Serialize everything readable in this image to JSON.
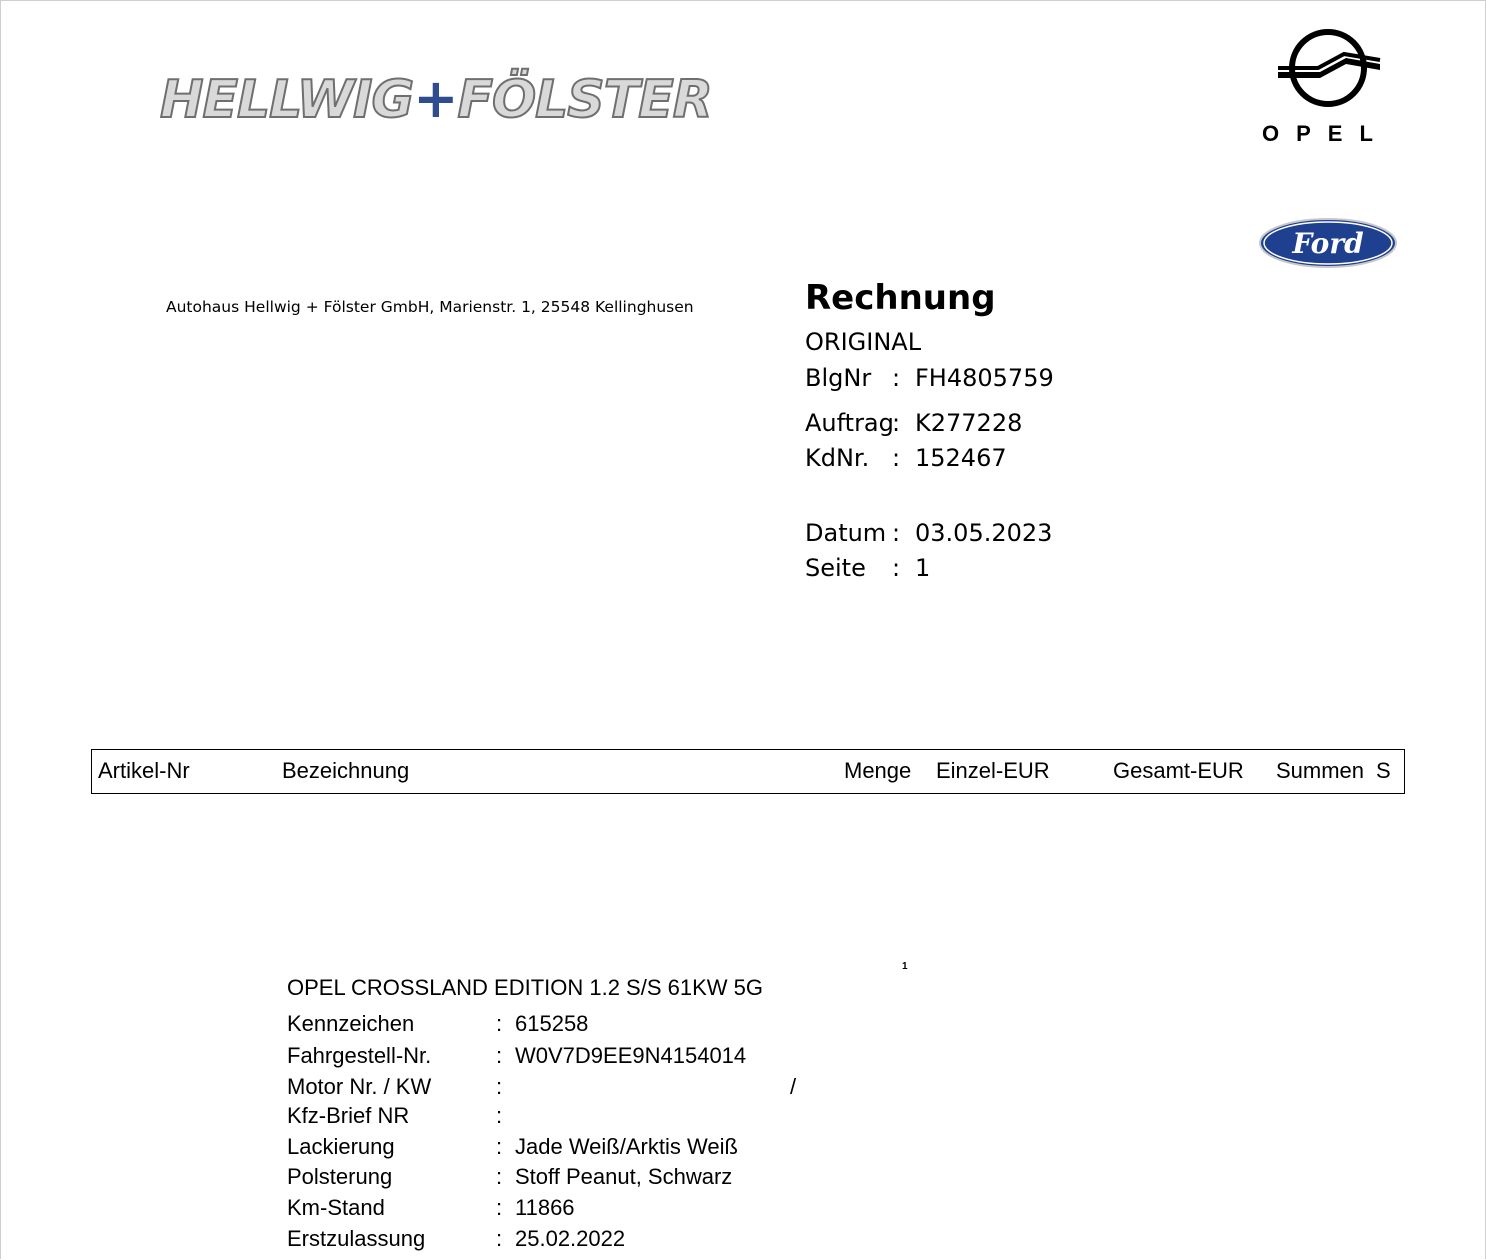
{
  "logos": {
    "dealer_logo_text_left": "HELLWIG",
    "dealer_logo_plus": "+",
    "dealer_logo_text_right": "FÖLSTER",
    "opel_wordmark": "OPEL",
    "ford_wordmark": "Ford",
    "ford_color": "#1f3f8f",
    "dealer_plus_color": "#2d4d8e"
  },
  "sender_line": "Autohaus Hellwig + Fölster GmbH, Marienstr. 1, 25548 Kellinghusen",
  "invoice": {
    "title": "Rechnung",
    "copy_type": "ORIGINAL",
    "fields": [
      {
        "label": "BlgNr",
        "value": "FH4805759"
      },
      {
        "label": "Auftrag",
        "value": "K277228"
      },
      {
        "label": "KdNr.",
        "value": "152467"
      },
      {
        "label": "Datum",
        "value": "03.05.2023"
      },
      {
        "label": "Seite",
        "value": "1"
      }
    ]
  },
  "columns": [
    "Artikel-Nr",
    "Bezeichnung",
    "Menge",
    "Einzel-EUR",
    "Gesamt-EUR",
    "Summen",
    "S"
  ],
  "line_marker": "1",
  "vehicle": {
    "title": "OPEL CROSSLAND EDITION 1.2 S/S 61KW 5G",
    "fields": [
      {
        "label": "Kennzeichen",
        "value": "615258"
      },
      {
        "label": "Fahrgestell-Nr.",
        "value": "W0V7D9EE9N4154014"
      },
      {
        "label": "Motor Nr. / KW",
        "value": ""
      },
      {
        "label": "Kfz-Brief NR",
        "value": ""
      },
      {
        "label": "Lackierung",
        "value": "Jade Weiß/Arktis Weiß"
      },
      {
        "label": "Polsterung",
        "value": "Stoff Peanut, Schwarz"
      },
      {
        "label": "Km-Stand",
        "value": "11866"
      },
      {
        "label": "Erstzulassung",
        "value": "25.02.2022"
      }
    ],
    "motor_separator": "/"
  }
}
